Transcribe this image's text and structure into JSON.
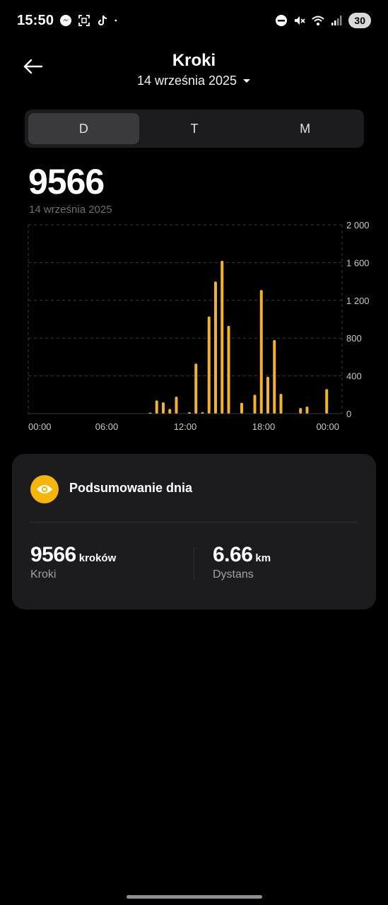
{
  "status_bar": {
    "time": "15:50",
    "battery": "30",
    "left_icons": [
      "messenger-icon",
      "screenshot-icon",
      "tiktok-icon",
      "dot-icon"
    ],
    "right_icons": [
      "dnd-icon",
      "mute-icon",
      "wifi-icon",
      "signal-icon"
    ]
  },
  "header": {
    "title": "Kroki",
    "date": "14 września 2025"
  },
  "tabs": [
    {
      "label": "D",
      "active": true
    },
    {
      "label": "T",
      "active": false
    },
    {
      "label": "M",
      "active": false
    }
  ],
  "summary_value": "9566",
  "summary_date": "14 września 2025",
  "colors": {
    "accent": "#f5b50a",
    "bar": "#f3b22b",
    "background": "#000000",
    "card": "#1c1c1e"
  },
  "chart_data": {
    "type": "bar",
    "x_tick_labels": [
      "00:00",
      "06:00",
      "12:00",
      "18:00",
      "00:00"
    ],
    "y_tick_labels": [
      "2 000",
      "1 600",
      "1 200",
      "800",
      "400",
      "0"
    ],
    "ylim": [
      0,
      2000
    ],
    "xlim_hours": [
      0,
      24
    ],
    "grid": true,
    "x_hours": [
      9.0,
      9.5,
      10.0,
      10.5,
      11.0,
      12.0,
      12.5,
      13.0,
      13.5,
      14.0,
      14.5,
      15.0,
      16.0,
      17.0,
      17.5,
      18.0,
      18.5,
      19.0,
      20.5,
      21.0,
      22.5
    ],
    "values": [
      10,
      140,
      120,
      50,
      180,
      15,
      530,
      15,
      1030,
      1400,
      1620,
      930,
      115,
      200,
      1310,
      390,
      780,
      210,
      60,
      75,
      260
    ]
  },
  "summary_card": {
    "title": "Podsumowanie dnia",
    "icon": "eye-icon",
    "steps_value": "9566",
    "steps_unit": "kroków",
    "steps_label": "Kroki",
    "distance_value": "6.66",
    "distance_unit": "km",
    "distance_label": "Dystans"
  }
}
